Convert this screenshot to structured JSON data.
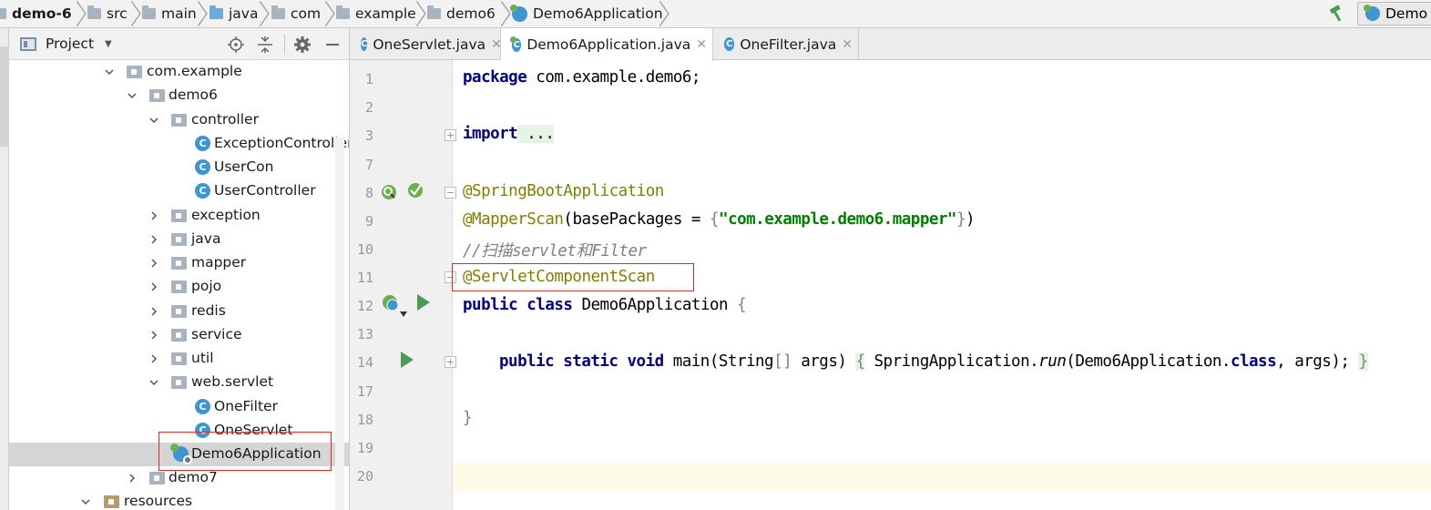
{
  "breadcrumb": {
    "project": "demo-6",
    "items": [
      "src",
      "main",
      "java",
      "com",
      "example",
      "demo6",
      "Demo6Application"
    ]
  },
  "run_config": {
    "label": "Demo"
  },
  "project_panel": {
    "title": "Project",
    "tree": [
      {
        "label": "com.example",
        "type": "package",
        "expanded": true
      },
      {
        "label": "demo6",
        "type": "package",
        "expanded": true
      },
      {
        "label": "controller",
        "type": "package",
        "expanded": true
      },
      {
        "label": "ExceptionController",
        "type": "class"
      },
      {
        "label": "UserCon",
        "type": "class"
      },
      {
        "label": "UserController",
        "type": "class"
      },
      {
        "label": "exception",
        "type": "package",
        "expanded": false
      },
      {
        "label": "java",
        "type": "package",
        "expanded": false
      },
      {
        "label": "mapper",
        "type": "package",
        "expanded": false
      },
      {
        "label": "pojo",
        "type": "package",
        "expanded": false
      },
      {
        "label": "redis",
        "type": "package",
        "expanded": false
      },
      {
        "label": "service",
        "type": "package",
        "expanded": false
      },
      {
        "label": "util",
        "type": "package",
        "expanded": false
      },
      {
        "label": "web.servlet",
        "type": "package",
        "expanded": true
      },
      {
        "label": "OneFilter",
        "type": "class"
      },
      {
        "label": "OneServlet",
        "type": "class"
      },
      {
        "label": "Demo6Application",
        "type": "boot-class",
        "selected": true
      },
      {
        "label": "demo7",
        "type": "package",
        "expanded": false
      },
      {
        "label": "resources",
        "type": "folder",
        "expanded": true
      }
    ]
  },
  "editor": {
    "tabs": [
      {
        "label": "OneServlet.java",
        "active": false
      },
      {
        "label": "Demo6Application.java",
        "active": true
      },
      {
        "label": "OneFilter.java",
        "active": false
      }
    ],
    "line_numbers": [
      "1",
      "2",
      "3",
      "7",
      "8",
      "9",
      "10",
      "11",
      "12",
      "13",
      "14",
      "17",
      "18",
      "19",
      "20"
    ],
    "code": {
      "l1_kw": "package",
      "l1_rest": " com.example.demo6;",
      "l3_kw": "import",
      "l3_fold": " ...",
      "l8_ann": "@SpringBootApplication",
      "l9_ann": "@MapperScan",
      "l9_a": "(basePackages = ",
      "l9_b": "{",
      "l9_str": "\"com.example.demo6.mapper\"",
      "l9_c": "}",
      "l9_d": ")",
      "l10_cmt": "//扫描servlet和Filter",
      "l11_ann": "@ServletComponentScan",
      "l12_kw": "public class",
      "l12_rest": " Demo6Application ",
      "l12_brace": "{",
      "l14_kw": "public static void",
      "l14_a": " main(String",
      "l14_b": "[]",
      "l14_c": " args) ",
      "l14_d": "{",
      "l14_e": " SpringApplication.",
      "l14_f": "run",
      "l14_g": "(Demo6Application.",
      "l14_h": "class",
      "l14_i": ", args); ",
      "l14_j": "}",
      "l18_brace": "}"
    }
  },
  "colors": {
    "keyword": "#000080",
    "annotation": "#808000",
    "string": "#008000",
    "comment": "#808080",
    "highlight_box": "#e0271f",
    "caret_line": "#fdfae6",
    "selection": "#d5d5d5"
  }
}
